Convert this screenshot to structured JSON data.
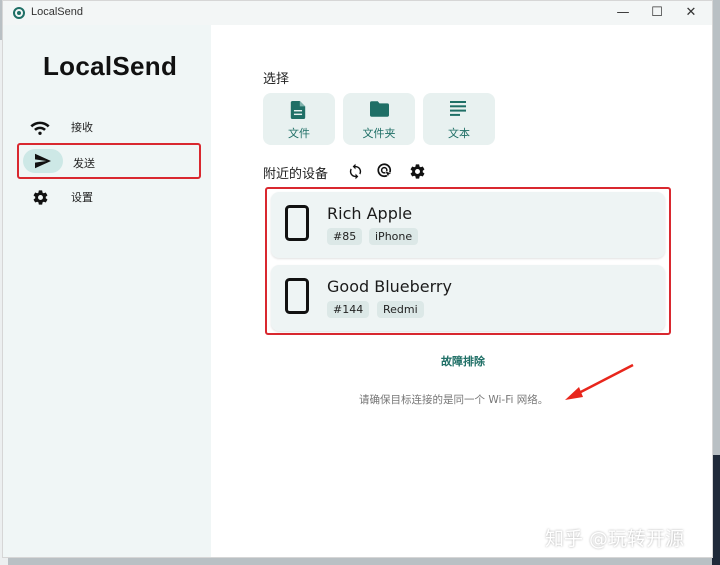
{
  "window": {
    "title": "LocalSend",
    "minimize": "—",
    "maximize": "☐",
    "close": "✕"
  },
  "sidebar": {
    "brand": "LocalSend",
    "items": [
      {
        "label": "接收",
        "icon": "wifi-icon"
      },
      {
        "label": "发送",
        "icon": "send-icon",
        "active": true
      },
      {
        "label": "设置",
        "icon": "gear-icon"
      }
    ]
  },
  "main": {
    "select_label": "选择",
    "types": [
      {
        "label": "文件",
        "icon": "file-icon"
      },
      {
        "label": "文件夹",
        "icon": "folder-icon"
      },
      {
        "label": "文本",
        "icon": "text-icon"
      }
    ],
    "nearby_label": "附近的设备",
    "devices": [
      {
        "name": "Rich Apple",
        "id": "#85",
        "model": "iPhone",
        "icon": "phone-icon"
      },
      {
        "name": "Good Blueberry",
        "id": "#144",
        "model": "Redmi",
        "icon": "phone-icon"
      }
    ],
    "troubleshoot": "故障排除",
    "hint": "请确保目标连接的是同一个 Wi-Fi 网络。"
  },
  "watermark": "知乎 @玩转开源",
  "colors": {
    "accent": "#1f6f66",
    "sidebar_bg": "#f0f6f6",
    "card_bg": "#eef4f4",
    "highlight_red": "#d9282f"
  }
}
